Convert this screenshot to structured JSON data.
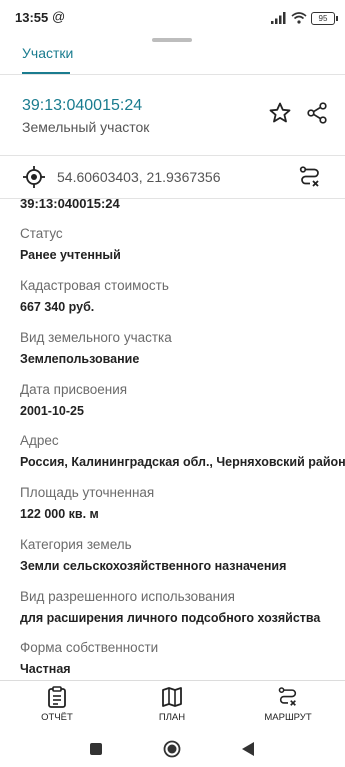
{
  "status_bar": {
    "time": "13:55",
    "at_symbol": "@",
    "battery": "95"
  },
  "tabs": [
    {
      "label": "Участки",
      "active": true
    }
  ],
  "header": {
    "cadastral_number": "39:13:040015:24",
    "object_type": "Земельный участок"
  },
  "coordinates": "54.60603403, 21.9367356",
  "details": {
    "partial_top_text": "39:13:040015:24",
    "fields": [
      {
        "label": "Статус",
        "value": "Ранее учтенный"
      },
      {
        "label": "Кадастровая стоимость",
        "value": "667 340 руб."
      },
      {
        "label": "Вид земельного участка",
        "value": "Землепользование"
      },
      {
        "label": "Дата присвоения",
        "value": "2001-10-25"
      },
      {
        "label": "Адрес",
        "value": "Россия, Калининградская обл., Черняховский район"
      },
      {
        "label": "Площадь уточненная",
        "value": "122 000 кв. м"
      },
      {
        "label": "Категория земель",
        "value": "Земли сельскохозяйственного назначения"
      },
      {
        "label": "Вид разрешенного использования",
        "value": "для расширения личного подсобного хозяйства"
      },
      {
        "label": "Форма собственности",
        "value": "Частная"
      }
    ]
  },
  "bottom_nav": [
    {
      "label": "ОТЧЁТ",
      "icon": "report-icon"
    },
    {
      "label": "ПЛАН",
      "icon": "map-icon"
    },
    {
      "label": "МАРШРУТ",
      "icon": "route-icon"
    }
  ],
  "colors": {
    "accent": "#1a7c8f",
    "text": "#222222",
    "label": "#6b6b6b"
  }
}
